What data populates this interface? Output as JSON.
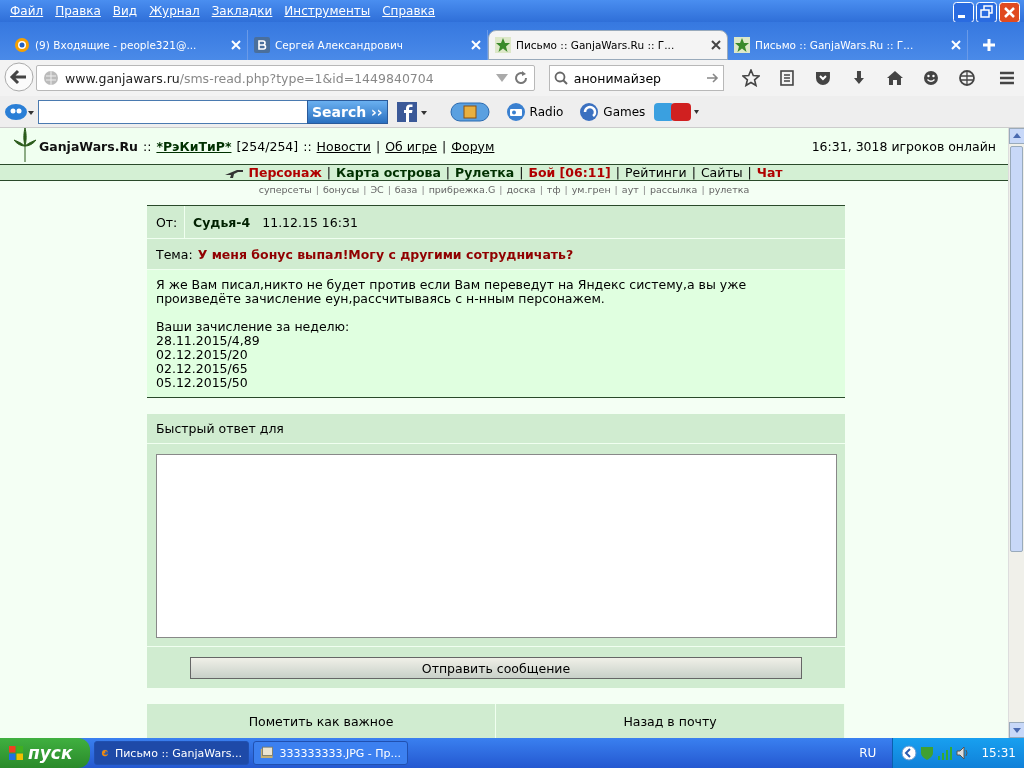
{
  "menu": [
    "Файл",
    "Правка",
    "Вид",
    "Журнал",
    "Закладки",
    "Инструменты",
    "Справка"
  ],
  "tabs": [
    {
      "title": "(9) Входящие - people321@...",
      "selected": false
    },
    {
      "title": "Сергей Александрович",
      "selected": false
    },
    {
      "title": "Письмо :: GanjaWars.Ru :: Г...",
      "selected": true
    },
    {
      "title": "Письмо :: GanjaWars.Ru :: Г...",
      "selected": false
    }
  ],
  "address": {
    "host": "www.ganjawars.ru",
    "path": "/sms-read.php?type=1&id=1449840704"
  },
  "search": {
    "value": "анонимайзер"
  },
  "toolbar": {
    "search_button": "Search ››",
    "radio": "Radio",
    "games": "Games"
  },
  "site": {
    "brand": "GanjaWars.Ru",
    "sep": "::",
    "user": "*РэКиТиР*",
    "hp": "[254/254]",
    "links": [
      "Новости",
      "Об игре",
      "Форум"
    ],
    "link_sep": "|",
    "online": "16:31, 3018 игроков онлайн"
  },
  "nav": {
    "separator": "|",
    "items": [
      {
        "label": "Персонаж",
        "kind": "alert"
      },
      {
        "label": "Карта острова",
        "kind": "main"
      },
      {
        "label": "Рулетка",
        "kind": "main"
      },
      {
        "label": "Бой [06:11]",
        "kind": "alert"
      },
      {
        "label": "Рейтинги",
        "kind": "plain"
      },
      {
        "label": "Сайты",
        "kind": "plain"
      },
      {
        "label": "Чат",
        "kind": "alert"
      }
    ]
  },
  "sub_links": {
    "separator": "|",
    "items": [
      "суперсеты",
      "бонусы",
      "ЭС",
      "база",
      "прибрежка.G",
      "доска",
      "тф",
      "ум.грен",
      "аут",
      "рассылка",
      "рулетка"
    ]
  },
  "message": {
    "from_label": "От:",
    "sender": "Судья-4",
    "date": "11.12.15 16:31",
    "subject_label": "Тема:",
    "subject": "У меня бонус выпал!Могу с другими сотрудничать?",
    "body": [
      [
        "Я же Вам писал,никто не будет против если Вам переведут на Яндекс систему,а вы уже произведёте зачисление еун,рассчитываясь с н-нным персонажем."
      ],
      [
        "Ваши зачисление за неделю:",
        "28.11.2015/4,89",
        "02.12.2015/20",
        "02.12.2015/65",
        "05.12.2015/50"
      ]
    ]
  },
  "reply": {
    "label": "Быстрый ответ для",
    "send_button": "Отправить сообщение",
    "actions": [
      "Пометить как важное",
      "Назад в почту"
    ]
  },
  "taskbar": {
    "start": "пуск",
    "tasks": [
      {
        "title": "Письмо :: GanjaWars...",
        "selected": true
      },
      {
        "title": "333333333.JPG - Пр...",
        "selected": false
      }
    ],
    "lang": "RU",
    "clock": "15:31"
  }
}
